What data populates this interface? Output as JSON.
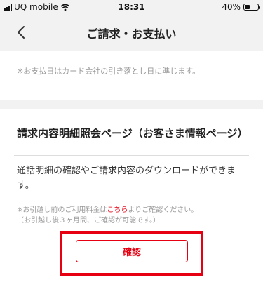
{
  "status_bar": {
    "carrier": "UQ mobile",
    "time": "18:31",
    "battery_percent": "40%",
    "battery_level": 0.4,
    "signal_icon": "signal-bars-icon",
    "wifi_icon": "wifi-icon",
    "battery_icon": "battery-icon"
  },
  "nav": {
    "title": "ご請求・お支払い",
    "back_icon": "chevron-left-icon"
  },
  "payment_note": "※お支払日はカード会社の引き落とし日に準じます。",
  "billing_section": {
    "heading": "請求内容明細照会ページ（お客さま情報ページ）",
    "description": "通話明細の確認やご請求内容のダウンロードができます。",
    "note_prefix": "※お引越し前のご利用料金は",
    "note_link": "こちら",
    "note_suffix": "よりご確認ください。",
    "note_line2": "（お引越し後３ヶ月間、ご確認が可能です。）",
    "confirm_label": "確認"
  },
  "colors": {
    "accent": "#e60012",
    "background": "#f2f2f2",
    "card": "#ffffff",
    "note_text": "#999999"
  }
}
